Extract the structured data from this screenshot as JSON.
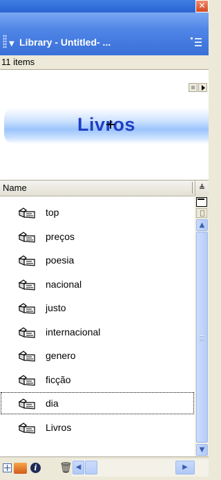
{
  "window": {
    "close_glyph": "✕"
  },
  "panel": {
    "title": "Library - Untitled- ...",
    "collapse_glyph": "▼",
    "item_count_text": "11 items"
  },
  "preview": {
    "banner_text": "Livros"
  },
  "list": {
    "column_header": "Name",
    "sort_glyph": "≜",
    "items": [
      {
        "label": "top",
        "icon": "button-symbol-icon"
      },
      {
        "label": "preços",
        "icon": "button-symbol-icon"
      },
      {
        "label": "poesia",
        "icon": "button-symbol-icon"
      },
      {
        "label": "nacional",
        "icon": "button-symbol-icon"
      },
      {
        "label": "justo",
        "icon": "button-symbol-icon"
      },
      {
        "label": "internacional",
        "icon": "button-symbol-icon"
      },
      {
        "label": "genero",
        "icon": "button-symbol-icon"
      },
      {
        "label": "ficção",
        "icon": "button-symbol-icon"
      },
      {
        "label": "dia",
        "icon": "button-symbol-icon",
        "selected": true
      },
      {
        "label": "Livros",
        "icon": "button-symbol-icon"
      }
    ]
  },
  "scrollbar": {
    "up_glyph": "▲",
    "down_glyph": "▼",
    "left_glyph": "◀",
    "right_glyph": "▶"
  },
  "toolbar": {
    "info_glyph": "i",
    "trash_glyph": "🗑"
  },
  "colors": {
    "titlebar": "#4f85e6",
    "banner_text": "#1f3fc6",
    "scroll_accent": "#b6cdf8"
  }
}
